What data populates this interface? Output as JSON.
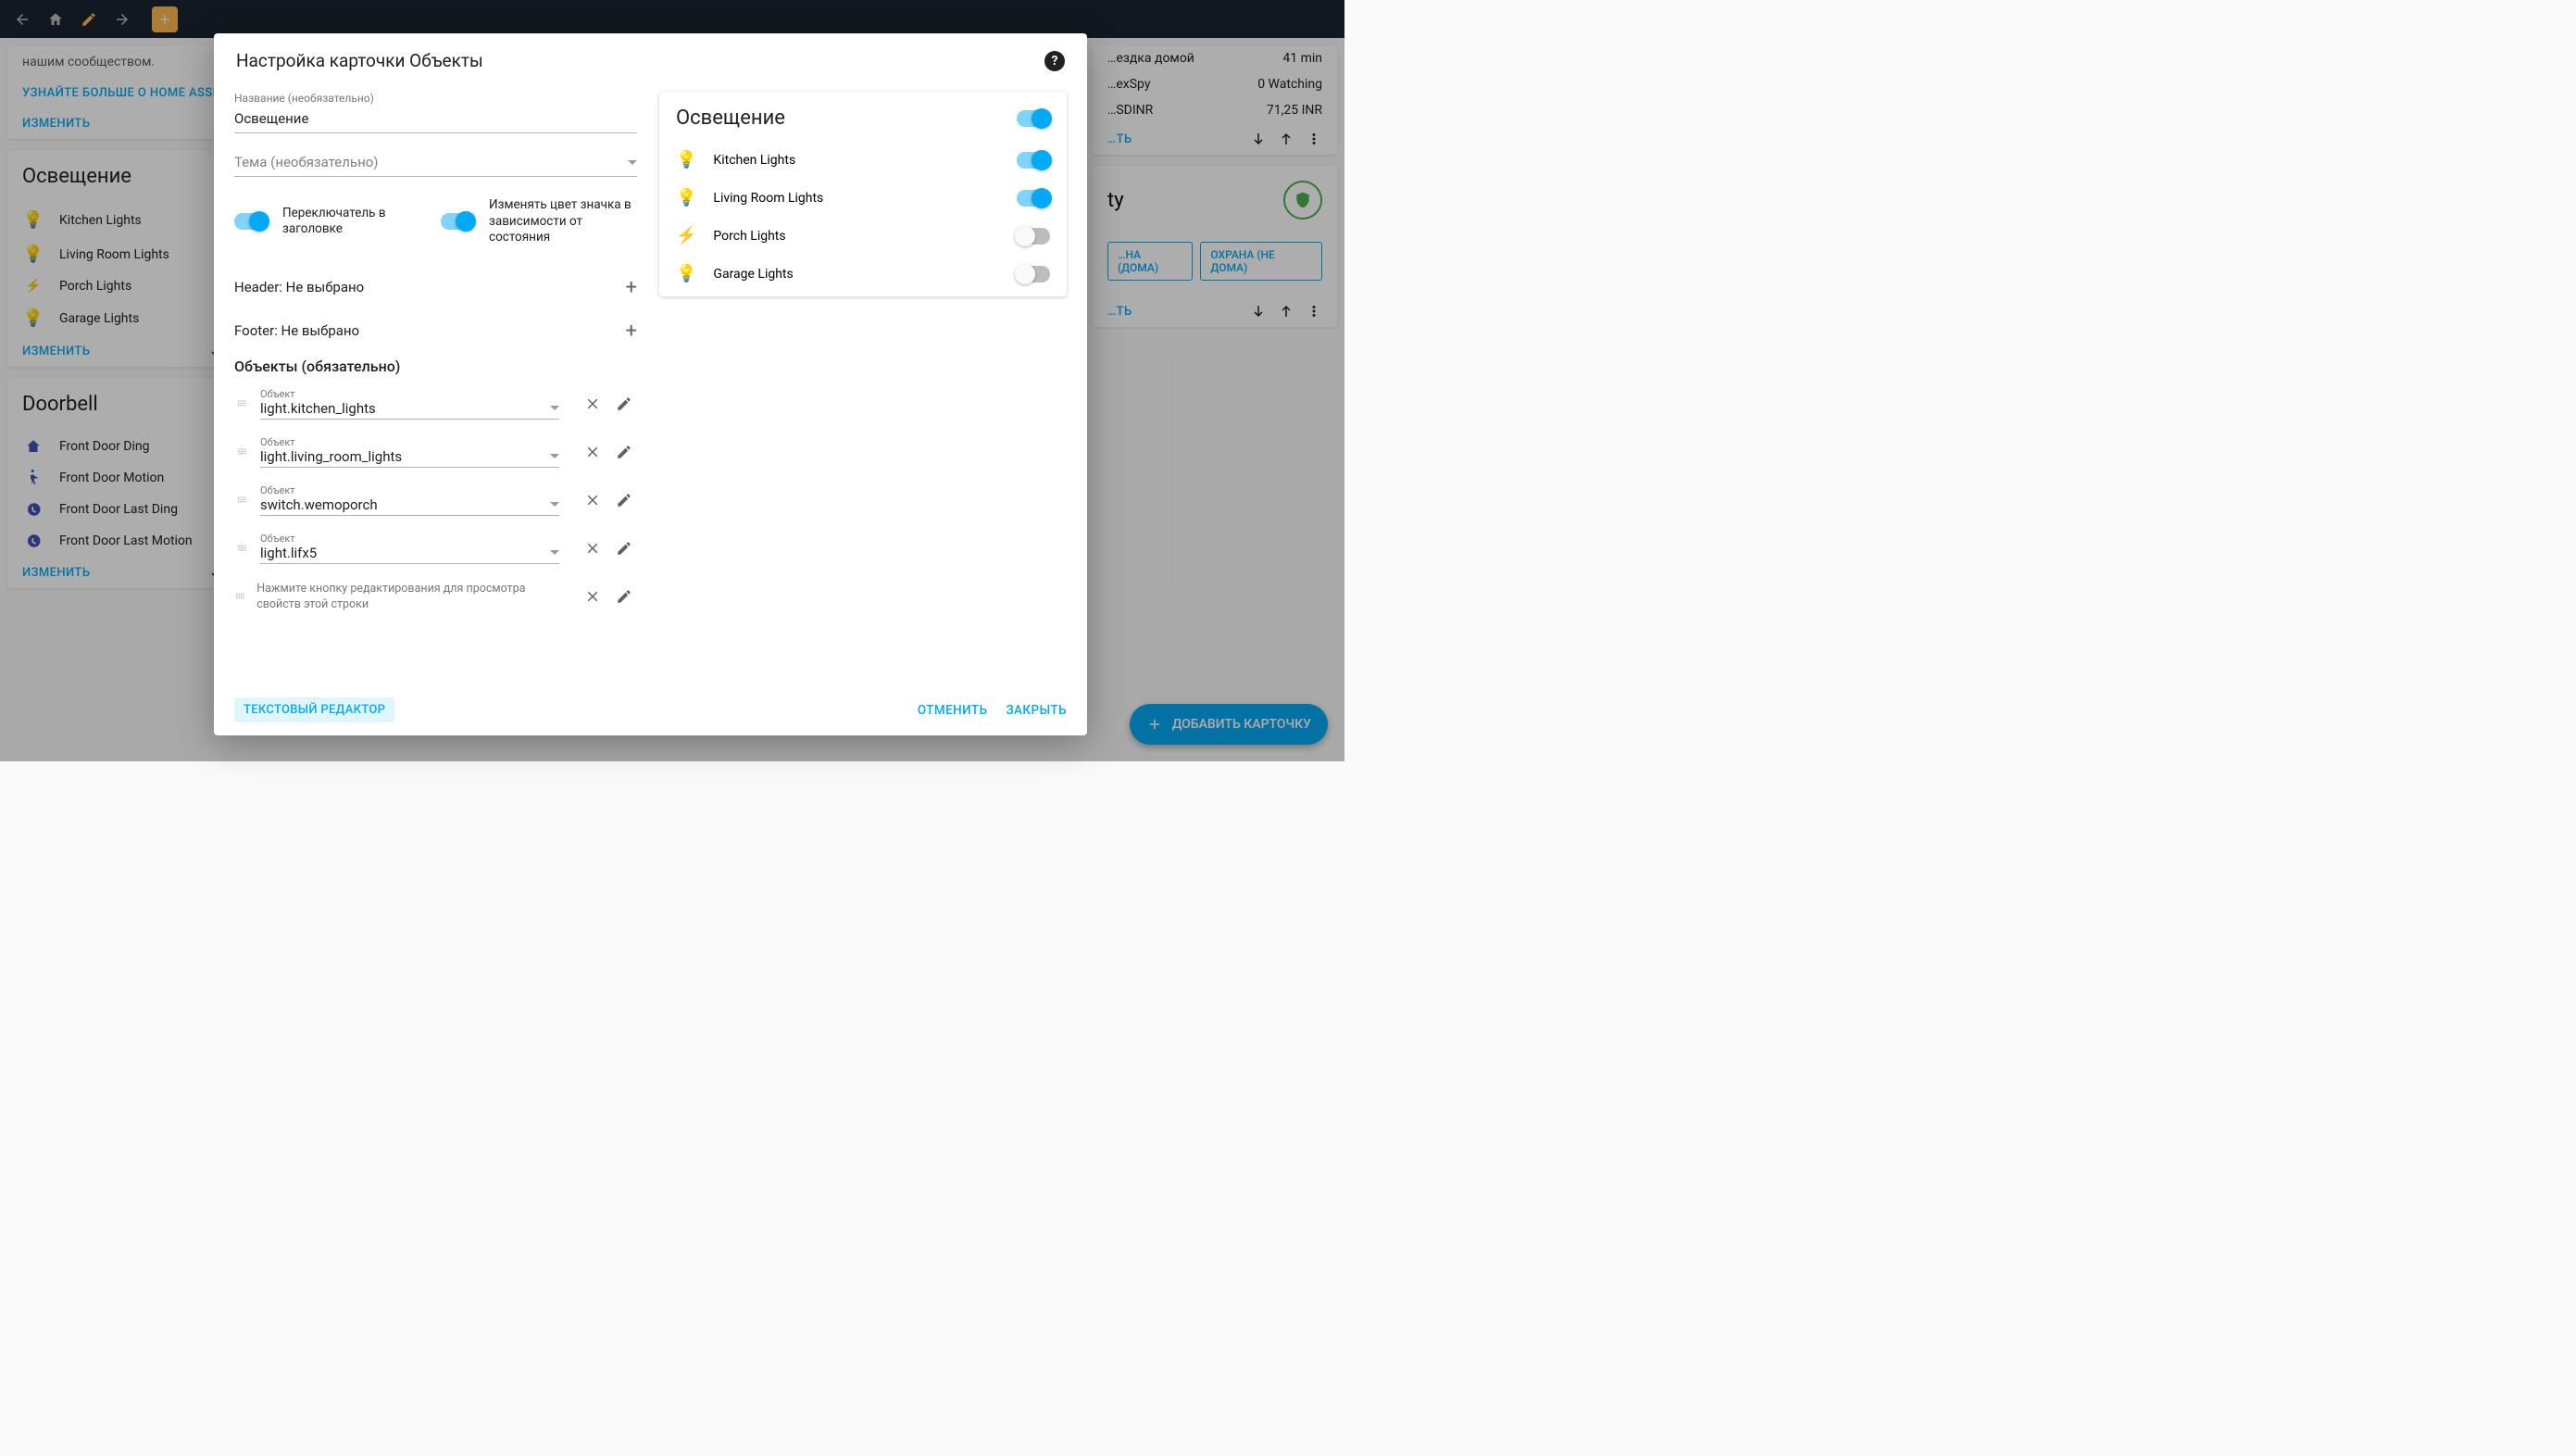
{
  "topbar": {},
  "bg": {
    "community_text": "нашим сообществом.",
    "learn_more": "УЗНАЙТЕ БОЛЬШЕ О HOME ASSI",
    "edit": "ИЗМЕНИТЬ",
    "cards": {
      "lighting": {
        "title": "Освещение",
        "items": [
          {
            "name": "Kitchen Lights",
            "color": "#f8a13f"
          },
          {
            "name": "Living Room Lights",
            "color": "#fdd835"
          },
          {
            "name": "Porch Lights",
            "color": "#3f51b5",
            "flash": true
          },
          {
            "name": "Garage Lights",
            "color": "#3f51b5"
          }
        ]
      },
      "doorbell": {
        "title": "Doorbell",
        "items": [
          {
            "name": "Front Door Ding",
            "icon": "home"
          },
          {
            "name": "Front Door Motion",
            "icon": "walk"
          },
          {
            "name": "Front Door Last Ding",
            "icon": "history"
          },
          {
            "name": "Front Door Last Motion",
            "icon": "history"
          }
        ]
      }
    },
    "right": {
      "rows": [
        {
          "name": "…ездка домой",
          "value": "41 min"
        },
        {
          "name": "…exSpy",
          "value": "0 Watching"
        },
        {
          "name": "…SDINR",
          "value": "71,25 INR"
        }
      ],
      "security_suffix": "ty",
      "arm_home": "…НА (ДОМА)",
      "arm_away": "ОХРАНА (НЕ ДОМА)",
      "edit_partial": "…ТЬ"
    },
    "fab": "ДОБАВИТЬ КАРТОЧКУ"
  },
  "dialog": {
    "title": "Настройка карточки Объекты",
    "name_label": "Название (необязательно)",
    "name_value": "Освещение",
    "theme_label": "Тема (необязательно)",
    "toggle_header": "Переключатель в заголовке",
    "toggle_color": "Изменять цвет значка в зависимости от состояния",
    "header_none": "Header: Не выбрано",
    "footer_none": "Footer: Не выбрано",
    "entities_heading": "Объекты (обязательно)",
    "entity_label": "Объект",
    "entities": [
      {
        "id": "light.kitchen_lights"
      },
      {
        "id": "light.living_room_lights"
      },
      {
        "id": "switch.wemoporch"
      },
      {
        "id": "light.lifx5"
      }
    ],
    "note": "Нажмите кнопку редактирования для просмотра свойств этой строки",
    "preview": {
      "title": "Освещение",
      "rows": [
        {
          "name": "Kitchen Lights",
          "color": "#f8a13f",
          "on": true
        },
        {
          "name": "Living Room Lights",
          "color": "#fdd835",
          "on": true
        },
        {
          "name": "Porch Lights",
          "color": "#3f51b5",
          "on": false,
          "flash": true
        },
        {
          "name": "Garage Lights",
          "color": "#3f51b5",
          "on": false
        }
      ]
    },
    "text_editor": "ТЕКСТОВЫЙ РЕДАКТОР",
    "cancel": "ОТМЕНИТЬ",
    "close": "ЗАКРЫТЬ"
  }
}
